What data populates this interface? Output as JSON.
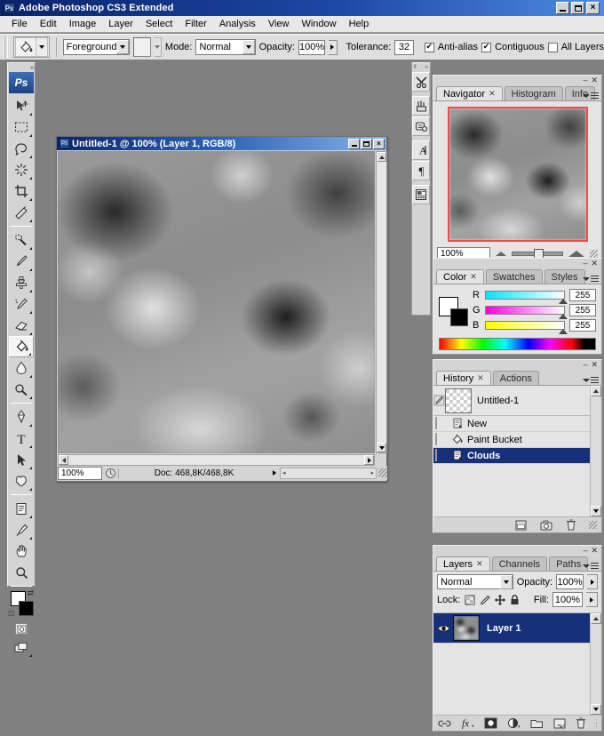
{
  "window": {
    "title": "Adobe Photoshop CS3 Extended",
    "app_icon": "photoshop-icon",
    "minimize": "_",
    "maximize": "□",
    "close": "×"
  },
  "menubar": {
    "items": [
      "File",
      "Edit",
      "Image",
      "Layer",
      "Select",
      "Filter",
      "Analysis",
      "View",
      "Window",
      "Help"
    ]
  },
  "options_bar": {
    "tool_icon": "paint-bucket-icon",
    "fill_source": "Foreground",
    "pattern_swatch": "",
    "mode_label": "Mode:",
    "mode_value": "Normal",
    "opacity_label": "Opacity:",
    "opacity_value": "100%",
    "tolerance_label": "Tolerance:",
    "tolerance_value": "32",
    "antialias_label": "Anti-alias",
    "antialias_checked": true,
    "contiguous_label": "Contiguous",
    "contiguous_checked": true,
    "all_layers_label": "All Layers",
    "all_layers_checked": false
  },
  "toolbox": {
    "logo": "Ps",
    "tools": [
      {
        "name": "move-tool",
        "selected": false
      },
      {
        "name": "rectangular-marquee-tool",
        "selected": false
      },
      {
        "name": "lasso-tool",
        "selected": false
      },
      {
        "name": "magic-wand-tool",
        "selected": false
      },
      {
        "name": "crop-tool",
        "selected": false
      },
      {
        "name": "slice-tool",
        "selected": false
      },
      {
        "name": "healing-brush-tool",
        "selected": false
      },
      {
        "name": "brush-tool",
        "selected": false
      },
      {
        "name": "clone-stamp-tool",
        "selected": false
      },
      {
        "name": "history-brush-tool",
        "selected": false
      },
      {
        "name": "eraser-tool",
        "selected": false
      },
      {
        "name": "paint-bucket-tool",
        "selected": true
      },
      {
        "name": "blur-tool",
        "selected": false
      },
      {
        "name": "dodge-tool",
        "selected": false
      },
      {
        "name": "pen-tool",
        "selected": false
      },
      {
        "name": "type-tool",
        "selected": false
      },
      {
        "name": "path-selection-tool",
        "selected": false
      },
      {
        "name": "shape-tool",
        "selected": false
      },
      {
        "name": "notes-tool",
        "selected": false
      },
      {
        "name": "eyedropper-tool",
        "selected": false
      },
      {
        "name": "hand-tool",
        "selected": false
      },
      {
        "name": "zoom-tool",
        "selected": false
      }
    ],
    "foreground_color": "#ffffff",
    "background_color": "#000000",
    "quick_mask": "quick-mask-icon",
    "screen_mode": "screen-mode-icon"
  },
  "document": {
    "title": "Untitled-1 @ 100% (Layer 1, RGB/8)",
    "minimize": "_",
    "maximize": "□",
    "close": "×",
    "status_zoom": "100%",
    "status_doc": "Doc: 468,8K/468,8K"
  },
  "icon_dock": {
    "buttons": [
      "tool-presets-icon",
      "brushes-icon",
      "clone-source-icon",
      "character-icon",
      "paragraph-icon",
      "layer-comps-icon"
    ]
  },
  "navigator": {
    "tabs": [
      {
        "label": "Navigator",
        "active": true,
        "closable": true
      },
      {
        "label": "Histogram",
        "active": false,
        "closable": false
      },
      {
        "label": "Info",
        "active": false,
        "closable": false
      }
    ],
    "zoom_value": "100%",
    "view_box_color": "#f04a4a",
    "zoom_out_icon": "zoom-out-icon",
    "zoom_in_icon": "zoom-in-icon"
  },
  "color_panel": {
    "tabs": [
      {
        "label": "Color",
        "active": true,
        "closable": true
      },
      {
        "label": "Swatches",
        "active": false,
        "closable": false
      },
      {
        "label": "Styles",
        "active": false,
        "closable": false
      }
    ],
    "channels": [
      {
        "label": "R",
        "value": "255",
        "from": "#00e5ff",
        "to": "#ffffff"
      },
      {
        "label": "G",
        "value": "255",
        "from": "#ff00e0",
        "to": "#ffffff"
      },
      {
        "label": "B",
        "value": "255",
        "from": "#ffff00",
        "to": "#ffffff"
      }
    ],
    "foreground_color": "#ffffff",
    "background_color": "#000000"
  },
  "history_panel": {
    "tabs": [
      {
        "label": "History",
        "active": true,
        "closable": true
      },
      {
        "label": "Actions",
        "active": false,
        "closable": false
      }
    ],
    "snapshot": {
      "label": "Untitled-1",
      "icon": "snapshot-thumb"
    },
    "states": [
      {
        "label": "New",
        "icon": "new-doc-icon",
        "selected": false
      },
      {
        "label": "Paint Bucket",
        "icon": "paint-bucket-icon",
        "selected": false
      },
      {
        "label": "Clouds",
        "icon": "clouds-state-icon",
        "selected": true
      }
    ],
    "footer_buttons": [
      "new-document-from-state-icon",
      "new-snapshot-icon",
      "delete-state-icon"
    ]
  },
  "layers_panel": {
    "tabs": [
      {
        "label": "Layers",
        "active": true,
        "closable": true
      },
      {
        "label": "Channels",
        "active": false,
        "closable": false
      },
      {
        "label": "Paths",
        "active": false,
        "closable": false
      }
    ],
    "blend_mode": "Normal",
    "opacity_label": "Opacity:",
    "opacity_value": "100%",
    "lock_label": "Lock:",
    "lock_icons": [
      "lock-transparency-icon",
      "lock-image-icon",
      "lock-position-icon",
      "lock-all-icon"
    ],
    "fill_label": "Fill:",
    "fill_value": "100%",
    "layers": [
      {
        "name": "Layer 1",
        "visible": true,
        "selected": true
      }
    ],
    "footer_buttons": [
      "link-layers-icon",
      "layer-style-icon",
      "layer-mask-icon",
      "adjustment-layer-icon",
      "new-group-icon",
      "new-layer-icon",
      "delete-layer-icon"
    ]
  },
  "colors": {
    "titlebar_start": "#0a246a",
    "titlebar_end": "#4f8ae0",
    "panel_bg": "#d4d4d4",
    "panel_body": "#e4e4e4",
    "selection": "#16307a",
    "workspace": "#808080"
  }
}
